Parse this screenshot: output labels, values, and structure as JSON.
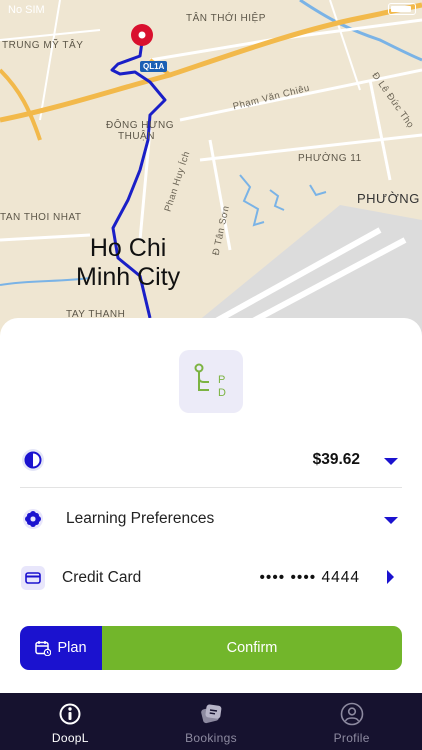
{
  "status_bar": {
    "carrier": "No SIM"
  },
  "map": {
    "labels": {
      "trung_my_tay": "TRUNG MỸ TÂY",
      "tan_thoi_hiep": "TÂN THỚI HIỆP",
      "dong_hung_thuan_1": "ĐÔNG HƯNG",
      "dong_hung_thuan_2": "THUẬN",
      "pham_van_chieu": "Phạm Văn Chiêu",
      "le_duc_tho": "Đ Lê Đức Thọ",
      "phuong_11": "PHƯỜNG 11",
      "phuong": "PHƯỜNG",
      "phan_huy_ich": "Phan Huy Ích",
      "tan_son": "Đ Tân Sơn",
      "tan_thoi_nhat": "TAN THOI NHAT",
      "city_line1": "Ho Chi",
      "city_line2": "Minh City",
      "tay_thanh": "TAY THANH",
      "ql1a": "QL1A"
    }
  },
  "sheet": {
    "price": "$39.62",
    "preferences_label": "Learning Preferences",
    "payment_label": "Credit Card",
    "card_mask": "•••• •••• 4444",
    "plan_label": "Plan",
    "confirm_label": "Confirm"
  },
  "tabs": [
    {
      "label": "DoopL",
      "icon": "info-icon",
      "active": true
    },
    {
      "label": "Bookings",
      "icon": "ticket-icon",
      "active": false
    },
    {
      "label": "Profile",
      "icon": "person-icon",
      "active": false
    }
  ],
  "colors": {
    "accent_blue": "#1b12cf",
    "confirm_green": "#72b62b",
    "tabbar_bg": "#16122f",
    "logo_green": "#7cb342",
    "route_blue": "#1a1fc7",
    "pin_red": "#d9102e"
  }
}
